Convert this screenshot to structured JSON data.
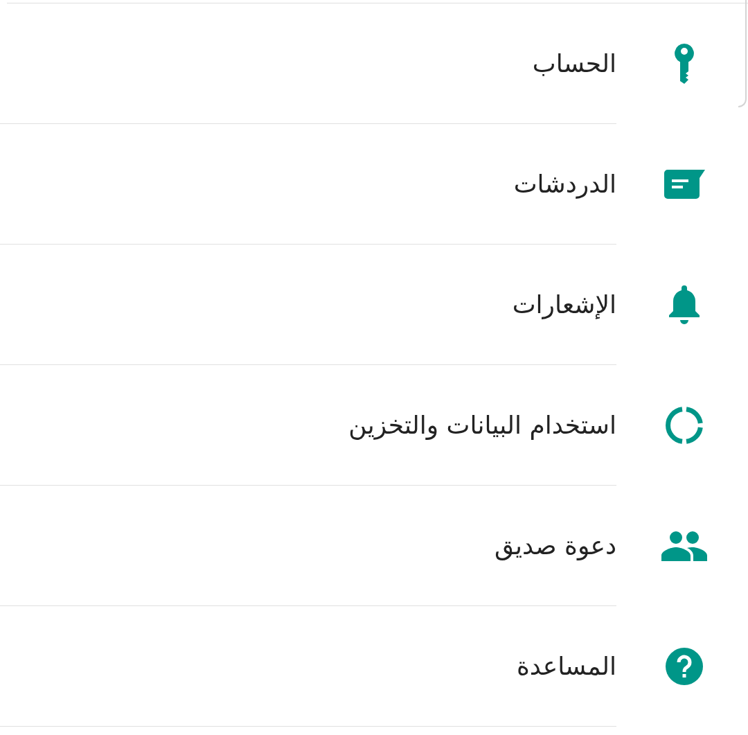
{
  "settings_items": [
    {
      "kind": "key",
      "label": "الحساب"
    },
    {
      "kind": "chat",
      "label": "الدردشات"
    },
    {
      "kind": "bell",
      "label": "الإشعارات"
    },
    {
      "kind": "data",
      "label": "استخدام البيانات والتخزين"
    },
    {
      "kind": "people",
      "label": "دعوة صديق"
    },
    {
      "kind": "help",
      "label": "المساعدة"
    }
  ]
}
